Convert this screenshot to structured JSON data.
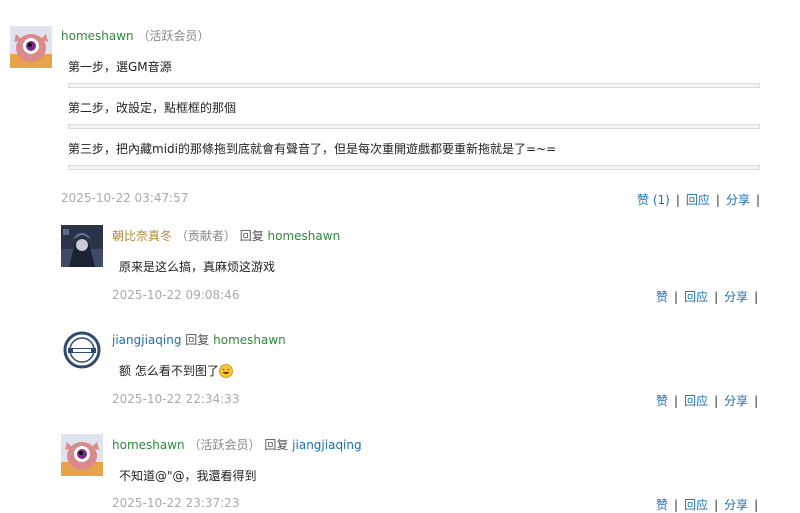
{
  "comments": [
    {
      "user": "homeshawn",
      "role": "（活跃会员）",
      "lines": [
        "第一步，選GM音源",
        "第二步，改設定，點框框的那個",
        "第三步，把內藏midi的那條拖到底就會有聲音了，但是每次重開遊戲都要重新拖就是了=~="
      ],
      "date": "2025-10-22 03:47:57",
      "like": "赞",
      "like_count": "(1)",
      "reply": "回应",
      "share": "分享"
    },
    {
      "user": "朝比奈真冬",
      "role": "（贡献者）",
      "reply_word": "回复",
      "reply_to": "homeshawn",
      "text": "原来是这么搞，真麻烦这游戏",
      "date": "2025-10-22 09:08:46",
      "like": "赞",
      "reply": "回应",
      "share": "分享"
    },
    {
      "user": "jiangjiaqing",
      "reply_word": "回复",
      "reply_to": "homeshawn",
      "text": "额  怎么看不到图了",
      "date": "2025-10-22 22:34:33",
      "like": "赞",
      "reply": "回应",
      "share": "分享"
    },
    {
      "user": "homeshawn",
      "role": "（活跃会员）",
      "reply_word": "回复",
      "reply_to": "jiangjiaqing",
      "text": "不知道@\"@，我還看得到",
      "date": "2025-10-22 23:37:23",
      "like": "赞",
      "reply": "回应",
      "share": "分享"
    }
  ]
}
